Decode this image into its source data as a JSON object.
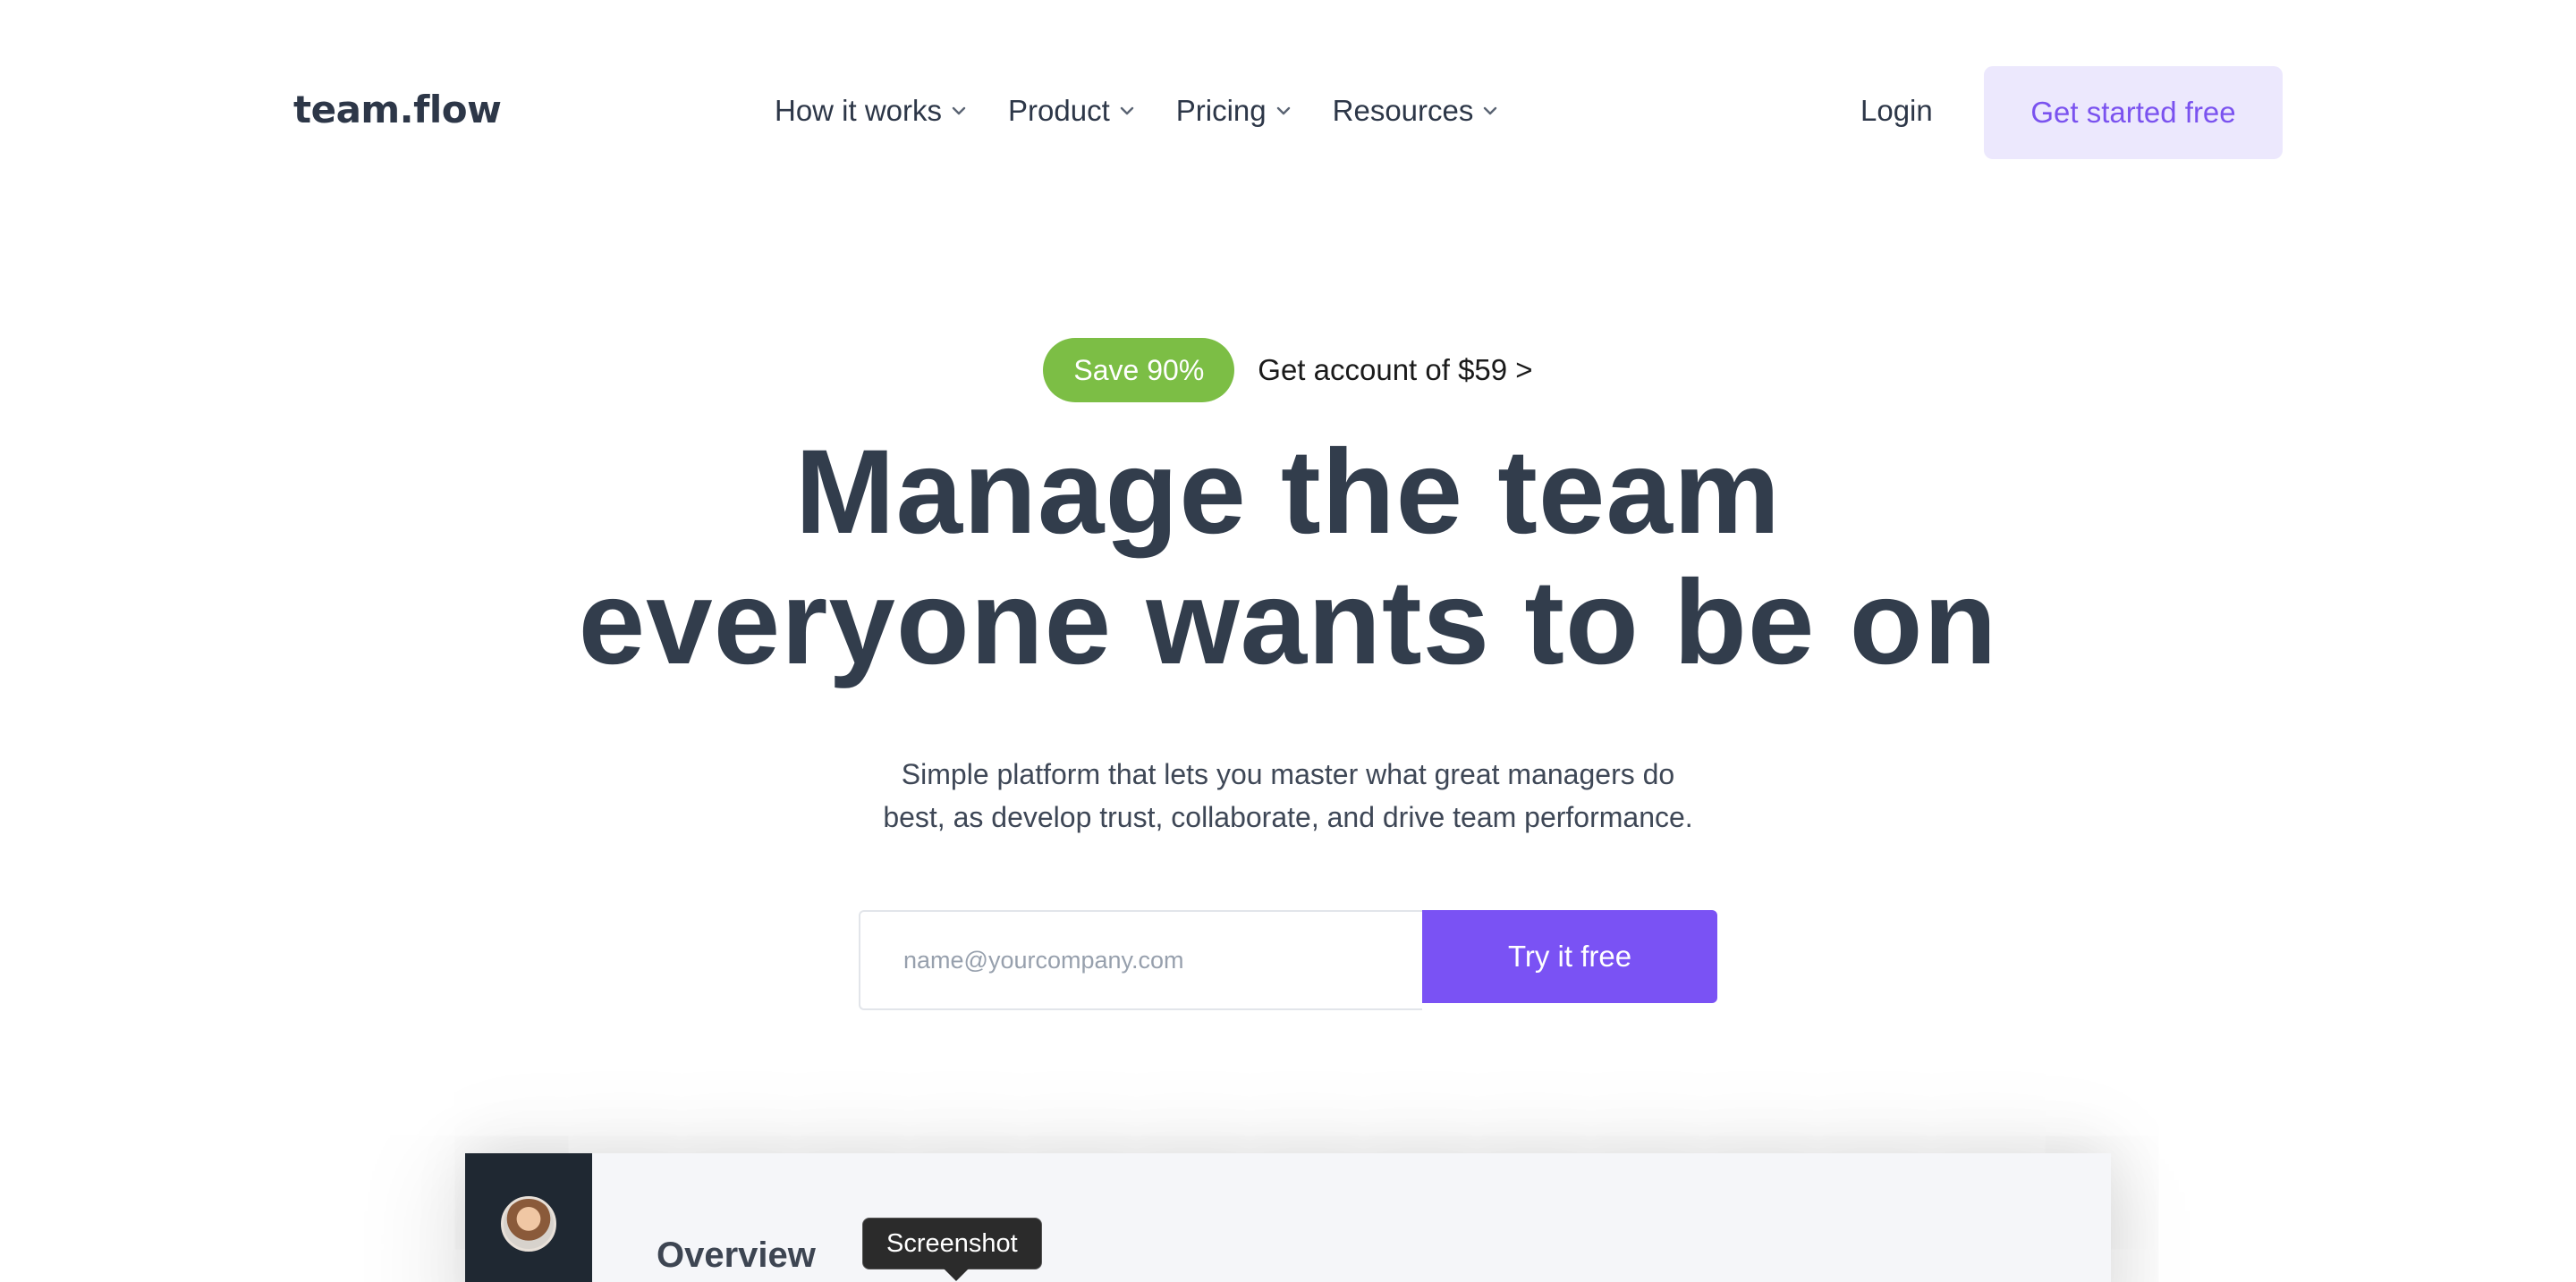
{
  "brand": {
    "logo": "team.flow"
  },
  "nav": {
    "items": [
      {
        "label": "How it works"
      },
      {
        "label": "Product"
      },
      {
        "label": "Pricing"
      },
      {
        "label": "Resources"
      }
    ],
    "login": "Login",
    "cta": "Get started free"
  },
  "hero": {
    "badge": "Save 90%",
    "promo_link": "Get account of $59 >",
    "headline_line1": "Manage the team",
    "headline_line2": "everyone wants to be on",
    "subtitle_line1": "Simple platform that lets you master what great managers do",
    "subtitle_line2": "best, as develop trust, collaborate, and drive team performance.",
    "email_placeholder": "name@yourcompany.com",
    "try_button": "Try it free"
  },
  "preview": {
    "title": "Overview"
  },
  "tooltip": "Screenshot",
  "colors": {
    "accent": "#7a52f4",
    "cta_bg": "#ece8fd",
    "badge": "#7cbe45",
    "heading": "#323d4c"
  }
}
